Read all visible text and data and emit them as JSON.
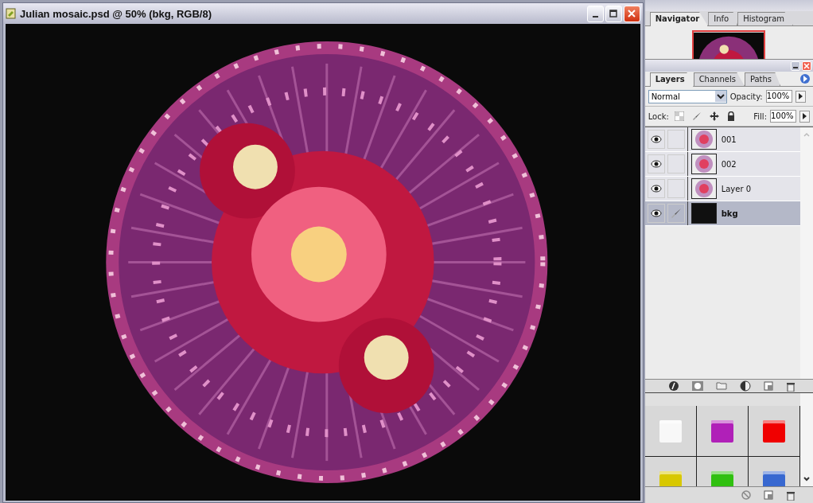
{
  "document": {
    "title": "Julian mosaic.psd @ 50% (bkg, RGB/8)"
  },
  "navigator": {
    "tabs": [
      {
        "label": "Navigator",
        "selected": true
      },
      {
        "label": "Info",
        "selected": false
      },
      {
        "label": "Histogram",
        "selected": false
      }
    ]
  },
  "layers_panel": {
    "tabs": [
      {
        "label": "Layers",
        "selected": true
      },
      {
        "label": "Channels",
        "selected": false
      },
      {
        "label": "Paths",
        "selected": false
      }
    ],
    "blend_mode": "Normal",
    "opacity_label": "Opacity:",
    "opacity": "100%",
    "lock_label": "Lock:",
    "fill_label": "Fill:",
    "fill": "100%",
    "layers": [
      {
        "name": "001",
        "visible": true,
        "selected": false
      },
      {
        "name": "002",
        "visible": true,
        "selected": false
      },
      {
        "name": "Layer 0",
        "visible": true,
        "selected": false
      },
      {
        "name": "bkg",
        "visible": true,
        "selected": true,
        "kind": "fill"
      }
    ]
  },
  "styles": {
    "swatches": [
      {
        "color": "#f8f8f8"
      },
      {
        "color": "#b020b8"
      },
      {
        "color": "#f00000"
      },
      {
        "color": "#d8c800"
      },
      {
        "color": "#30c010"
      },
      {
        "color": "#3868d0"
      }
    ]
  }
}
